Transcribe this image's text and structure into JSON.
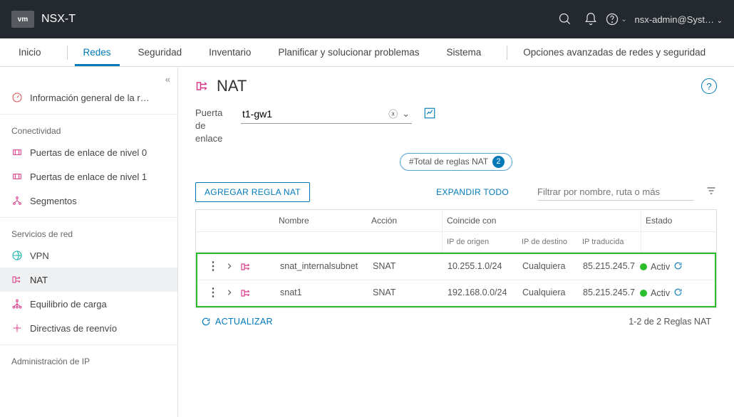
{
  "header": {
    "logo": "vm",
    "product": "NSX-T",
    "user": "nsx-admin@Syst…"
  },
  "tabs": [
    "Inicio",
    "Redes",
    "Seguridad",
    "Inventario",
    "Planificar y solucionar problemas",
    "Sistema",
    "Opciones avanzadas de redes y seguridad"
  ],
  "tabs_active_index": 1,
  "sidebar": {
    "overview_label": "Información general de la r…",
    "section_connectivity": "Conectividad",
    "tier0_label": "Puertas de enlace de nivel 0",
    "tier1_label": "Puertas de enlace de nivel 1",
    "segments_label": "Segmentos",
    "section_netservices": "Servicios de red",
    "vpn_label": "VPN",
    "nat_label": "NAT",
    "lb_label": "Equilibrio de carga",
    "fwd_label": "Directivas de reenvío",
    "section_ipadmin": "Administración de IP"
  },
  "page": {
    "title": "NAT",
    "gateway_label0": "Puerta",
    "gateway_label1": "de",
    "gateway_label2": "enlace",
    "gateway_value": "t1-gw1",
    "badge_label": "#Total de reglas NAT",
    "badge_count": "2",
    "add_button": "AGREGAR REGLA NAT",
    "expand_all": "EXPANDIR TODO",
    "filter_placeholder": "Filtrar por nombre, ruta o más",
    "columns": {
      "name": "Nombre",
      "action": "Acción",
      "match": "Coincide con",
      "src": "IP de origen",
      "dst": "IP de destino",
      "trans": "IP traducida",
      "status": "Estado"
    },
    "rows": [
      {
        "name": "snat_internalsubnet",
        "action": "SNAT",
        "src": "10.255.1.0/24",
        "dst": "Cualquiera",
        "trans": "85.215.245.7",
        "status": "Activ"
      },
      {
        "name": "snat1",
        "action": "SNAT",
        "src": "192.168.0.0/24",
        "dst": "Cualquiera",
        "trans": "85.215.245.7",
        "status": "Activ"
      }
    ],
    "refresh": "ACTUALIZAR",
    "count_label": "1-2 de 2 Reglas NAT"
  }
}
